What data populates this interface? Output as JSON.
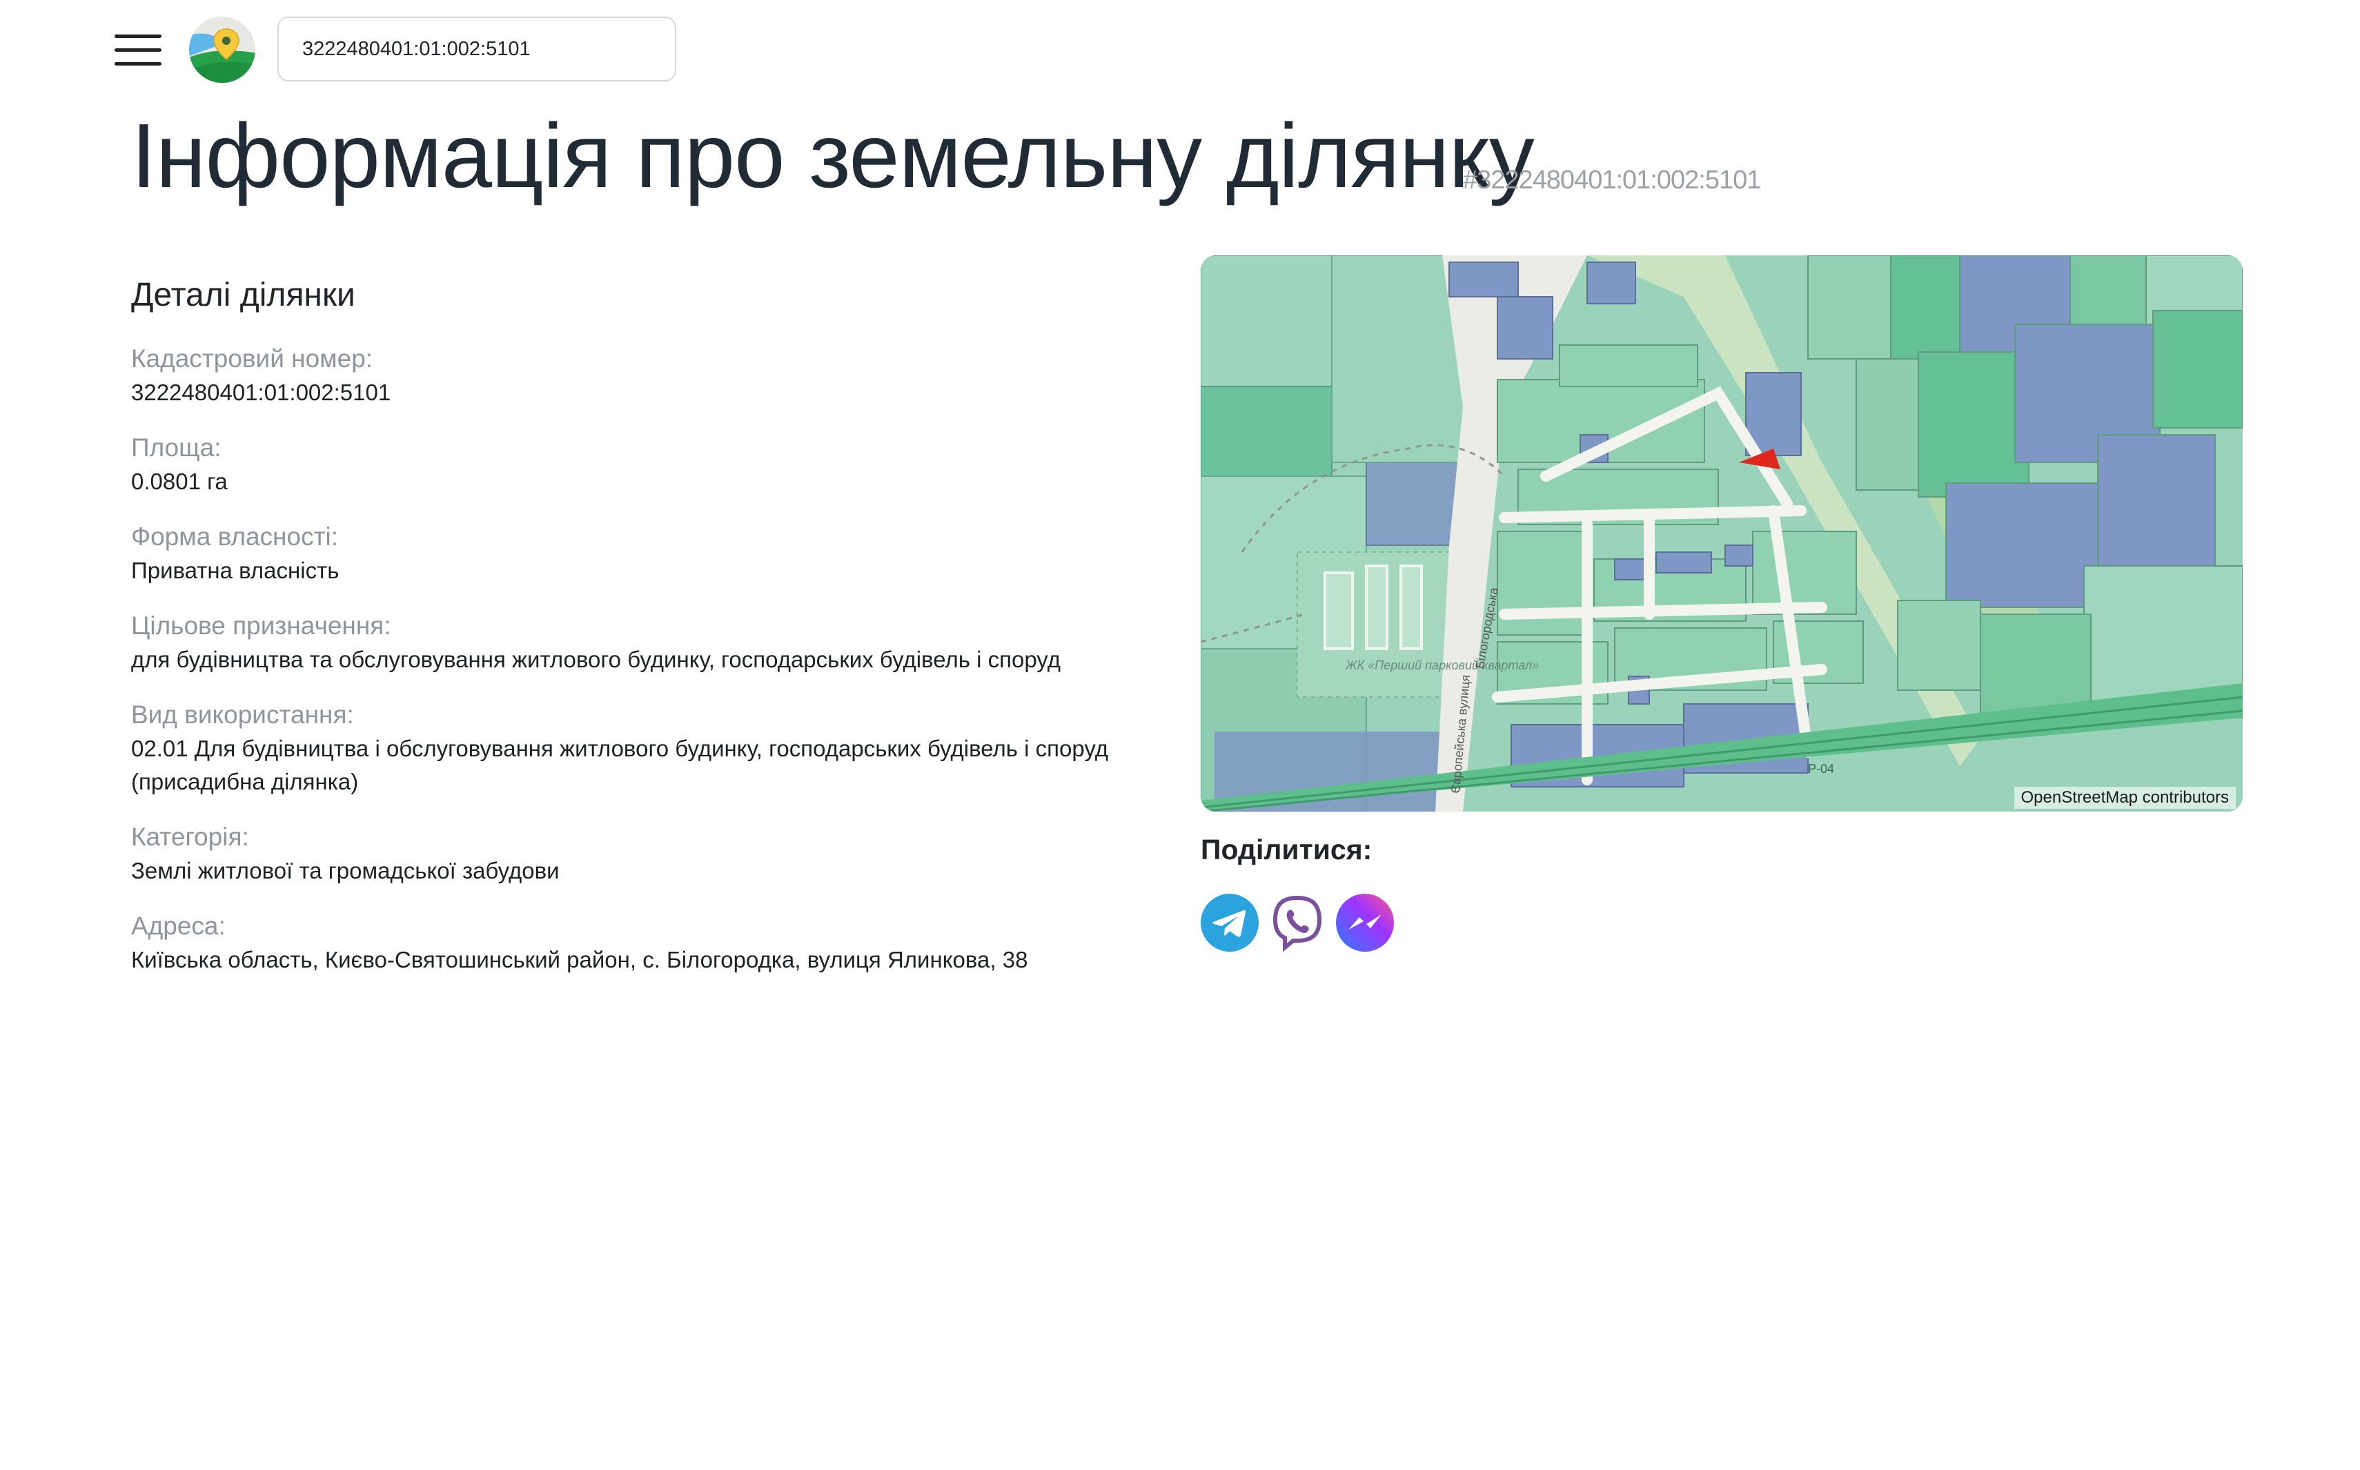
{
  "header": {
    "menu_icon": "hamburger-menu-icon",
    "logo_icon": "map-pin-logo-icon",
    "search": {
      "value": "3222480401:01:002:5101",
      "placeholder": ""
    }
  },
  "page": {
    "title": "Інформація про земельну ділянку",
    "id_hash": "#3222480401:01:002:5101"
  },
  "details": {
    "heading": "Деталі ділянки",
    "fields": [
      {
        "label": "Кадастровий номер:",
        "value": "3222480401:01:002:5101"
      },
      {
        "label": "Площа:",
        "value": "0.0801 га"
      },
      {
        "label": "Форма власності:",
        "value": "Приватна власність"
      },
      {
        "label": "Цільове призначення:",
        "value": "для будівництва та обслуговування житлового будинку, господарських будівель і споруд"
      },
      {
        "label": "Вид використання:",
        "value": "02.01 Для будівництва і обслуговування житлового будинку, господарських будівель і споруд (присадибна ділянка)"
      },
      {
        "label": "Категорія:",
        "value": "Землі житлової та громадської забудови"
      },
      {
        "label": "Адреса:",
        "value": "Київська область, Києво-Святошинський район, с. Білогородка, вулиця Ялинкова, 38"
      }
    ]
  },
  "map": {
    "attribution": "OpenStreetMap contributors",
    "labels": {
      "park": "ЖК «Перший парковий квартал»",
      "street_evro": "Європейська вулиця",
      "street_bilo": "Білогородська",
      "road": "Р-04"
    },
    "colors": {
      "parcel_green": "#7fc8a4",
      "parcel_blue": "#7f97c4",
      "highlight": "#e0271d"
    }
  },
  "share": {
    "label": "Поділитися:",
    "buttons": [
      {
        "name": "telegram",
        "icon": "telegram-icon",
        "color": "#2aa3df"
      },
      {
        "name": "viber",
        "icon": "viber-icon",
        "color": "#7b519d"
      },
      {
        "name": "messenger",
        "icon": "messenger-icon",
        "color": "#6a5cff"
      }
    ]
  }
}
